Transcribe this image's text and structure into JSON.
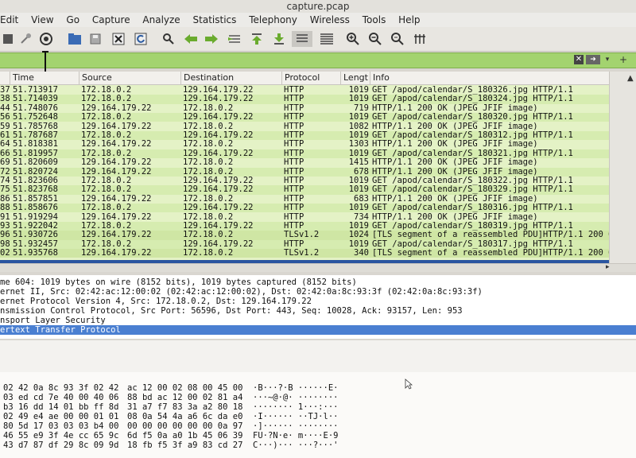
{
  "window": {
    "title": "capture.pcap"
  },
  "menu": [
    "Edit",
    "View",
    "Go",
    "Capture",
    "Analyze",
    "Statistics",
    "Telephony",
    "Wireless",
    "Tools",
    "Help"
  ],
  "menu_labels": [
    "Edit",
    "View",
    "Go",
    "Capture",
    "Analyze",
    "Statistics",
    "Telephony",
    "Wireless",
    "Tools",
    "Help"
  ],
  "toolbar_icons": [
    "stop-capture-icon",
    "restart-capture-icon",
    "capture-options-icon",
    "open-file-icon",
    "save-file-icon",
    "close-file-icon",
    "reload-file-icon",
    "find-packet-icon",
    "go-back-icon",
    "go-forward-icon",
    "go-to-packet-icon",
    "go-first-icon",
    "go-last-icon",
    "autoscroll-icon",
    "colorize-icon",
    "zoom-in-icon",
    "zoom-out-icon",
    "zoom-normal-icon",
    "resize-columns-icon"
  ],
  "filter": {
    "value": "",
    "placeholder": ""
  },
  "columns": {
    "time": "Time",
    "source": "Source",
    "destination": "Destination",
    "protocol": "Protocol",
    "length": "Lengt",
    "info": "Info"
  },
  "packets": [
    {
      "no": "37",
      "time": "51.713917",
      "src": "172.18.0.2",
      "dst": "129.164.179.22",
      "proto": "HTTP",
      "len": "1019",
      "info": "GET /apod/calendar/S_180326.jpg HTTP/1.1"
    },
    {
      "no": "38",
      "time": "51.714039",
      "src": "172.18.0.2",
      "dst": "129.164.179.22",
      "proto": "HTTP",
      "len": "1019",
      "info": "GET /apod/calendar/S_180324.jpg HTTP/1.1"
    },
    {
      "no": "44",
      "time": "51.748076",
      "src": "129.164.179.22",
      "dst": "172.18.0.2",
      "proto": "HTTP",
      "len": "719",
      "info": "HTTP/1.1 200 OK  (JPEG JFIF image)"
    },
    {
      "no": "56",
      "time": "51.752648",
      "src": "172.18.0.2",
      "dst": "129.164.179.22",
      "proto": "HTTP",
      "len": "1019",
      "info": "GET /apod/calendar/S_180320.jpg HTTP/1.1"
    },
    {
      "no": "59",
      "time": "51.785768",
      "src": "129.164.179.22",
      "dst": "172.18.0.2",
      "proto": "HTTP",
      "len": "1082",
      "info": "HTTP/1.1 200 OK  (JPEG JFIF image)"
    },
    {
      "no": "61",
      "time": "51.787687",
      "src": "172.18.0.2",
      "dst": "129.164.179.22",
      "proto": "HTTP",
      "len": "1019",
      "info": "GET /apod/calendar/S_180312.jpg HTTP/1.1"
    },
    {
      "no": "64",
      "time": "51.818381",
      "src": "129.164.179.22",
      "dst": "172.18.0.2",
      "proto": "HTTP",
      "len": "1303",
      "info": "HTTP/1.1 200 OK  (JPEG JFIF image)"
    },
    {
      "no": "66",
      "time": "51.819957",
      "src": "172.18.0.2",
      "dst": "129.164.179.22",
      "proto": "HTTP",
      "len": "1019",
      "info": "GET /apod/calendar/S_180321.jpg HTTP/1.1"
    },
    {
      "no": "69",
      "time": "51.820609",
      "src": "129.164.179.22",
      "dst": "172.18.0.2",
      "proto": "HTTP",
      "len": "1415",
      "info": "HTTP/1.1 200 OK  (JPEG JFIF image)"
    },
    {
      "no": "72",
      "time": "51.820724",
      "src": "129.164.179.22",
      "dst": "172.18.0.2",
      "proto": "HTTP",
      "len": "678",
      "info": "HTTP/1.1 200 OK  (JPEG JFIF image)"
    },
    {
      "no": "74",
      "time": "51.823606",
      "src": "172.18.0.2",
      "dst": "129.164.179.22",
      "proto": "HTTP",
      "len": "1019",
      "info": "GET /apod/calendar/S_180322.jpg HTTP/1.1"
    },
    {
      "no": "75",
      "time": "51.823768",
      "src": "172.18.0.2",
      "dst": "129.164.179.22",
      "proto": "HTTP",
      "len": "1019",
      "info": "GET /apod/calendar/S_180329.jpg HTTP/1.1"
    },
    {
      "no": "86",
      "time": "51.857851",
      "src": "129.164.179.22",
      "dst": "172.18.0.2",
      "proto": "HTTP",
      "len": "683",
      "info": "HTTP/1.1 200 OK  (JPEG JFIF image)"
    },
    {
      "no": "88",
      "time": "51.858676",
      "src": "172.18.0.2",
      "dst": "129.164.179.22",
      "proto": "HTTP",
      "len": "1019",
      "info": "GET /apod/calendar/S_180316.jpg HTTP/1.1"
    },
    {
      "no": "91",
      "time": "51.919294",
      "src": "129.164.179.22",
      "dst": "172.18.0.2",
      "proto": "HTTP",
      "len": "734",
      "info": "HTTP/1.1 200 OK  (JPEG JFIF image)"
    },
    {
      "no": "93",
      "time": "51.922042",
      "src": "172.18.0.2",
      "dst": "129.164.179.22",
      "proto": "HTTP",
      "len": "1019",
      "info": "GET /apod/calendar/S_180319.jpg HTTP/1.1"
    },
    {
      "no": "96",
      "time": "51.930726",
      "src": "129.164.179.22",
      "dst": "172.18.0.2",
      "proto": "TLSv1.2",
      "len": "1024",
      "info": "[TLS segment of a reassembled PDU]HTTP/1.1 200 OK"
    },
    {
      "no": "98",
      "time": "51.932457",
      "src": "172.18.0.2",
      "dst": "129.164.179.22",
      "proto": "HTTP",
      "len": "1019",
      "info": "GET /apod/calendar/S_180317.jpg HTTP/1.1"
    },
    {
      "no": "02",
      "time": "51.935768",
      "src": "129.164.179.22",
      "dst": "172.18.0.2",
      "proto": "TLSv1.2",
      "len": "340",
      "info": "[TLS segment of a reassembled PDU]HTTP/1.1 200 OK"
    }
  ],
  "details": [
    "me 604: 1019 bytes on wire (8152 bits), 1019 bytes captured (8152 bits)",
    "ernet II, Src: 02:42:ac:12:00:02 (02:42:ac:12:00:02), Dst: 02:42:0a:8c:93:3f (02:42:0a:8c:93:3f)",
    "ernet Protocol Version 4, Src: 172.18.0.2, Dst: 129.164.179.22",
    "nsmission Control Protocol, Src Port: 56596, Dst Port: 443, Seq: 10028, Ack: 93157, Len: 953",
    "nsport Layer Security",
    "ertext Transfer Protocol"
  ],
  "selected_detail": 5,
  "bytes": [
    {
      "hex1": "02 42 0a 8c 93 3f 02 42",
      "hex2": "ac 12 00 02 08 00 45 00",
      "ascii": "·B···?·B ······E·"
    },
    {
      "hex1": "03 ed cd 7e 40 00 40 06",
      "hex2": "88 bd ac 12 00 02 81 a4",
      "ascii": "···~@·@· ········"
    },
    {
      "hex1": "b3 16 dd 14 01 bb ff 8d",
      "hex2": "31 a7 f7 83 3a a2 80 18",
      "ascii": "········ 1···:···"
    },
    {
      "hex1": "02 49 e4 ae 00 00 01 01",
      "hex2": "08 0a 54 4a a6 6c da e0",
      "ascii": "·I······ ··TJ·l··"
    },
    {
      "hex1": "80 5d 17 03 03 03 b4 00",
      "hex2": "00 00 00 00 00 00 0a 97",
      "ascii": "·]······ ········"
    },
    {
      "hex1": "46 55 e9 3f 4e cc 65 9c",
      "hex2": "6d f5 0a a0 1b 45 06 39",
      "ascii": "FU·?N·e· m····E·9"
    },
    {
      "hex1": "43 d7 87 df 29 8c 09 9d",
      "hex2": "18 fb f5 3f a9 83 cd 27",
      "ascii": "C···)··· ···?···'"
    }
  ]
}
